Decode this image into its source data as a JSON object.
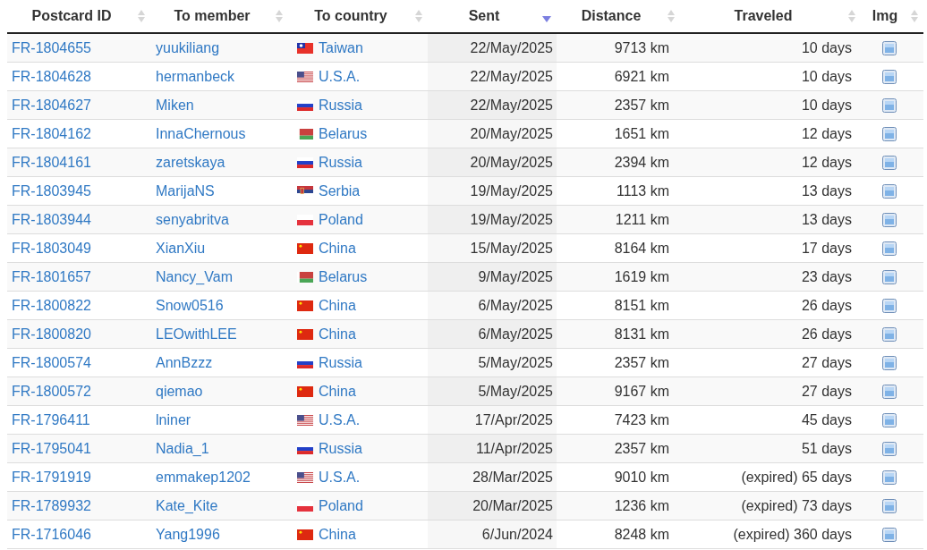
{
  "table": {
    "columns": [
      {
        "label": "Postcard ID",
        "sorted": false
      },
      {
        "label": "To member",
        "sorted": false
      },
      {
        "label": "To country",
        "sorted": false
      },
      {
        "label": "Sent",
        "sorted": true
      },
      {
        "label": "Distance",
        "sorted": false
      },
      {
        "label": "Traveled",
        "sorted": false
      },
      {
        "label": "Img",
        "sorted": false
      }
    ],
    "rows": [
      {
        "id": "FR-1804655",
        "member": "yuukiliang",
        "country": {
          "kind": "tw",
          "name": "Taiwan"
        },
        "sent": "22/May/2025",
        "distance": "9713 km",
        "traveled": "10 days"
      },
      {
        "id": "FR-1804628",
        "member": "hermanbeck",
        "country": {
          "kind": "us",
          "name": "U.S.A."
        },
        "sent": "22/May/2025",
        "distance": "6921 km",
        "traveled": "10 days"
      },
      {
        "id": "FR-1804627",
        "member": "Miken",
        "country": {
          "kind": "ru",
          "name": "Russia"
        },
        "sent": "22/May/2025",
        "distance": "2357 km",
        "traveled": "10 days"
      },
      {
        "id": "FR-1804162",
        "member": "InnaChernous",
        "country": {
          "kind": "by",
          "name": "Belarus"
        },
        "sent": "20/May/2025",
        "distance": "1651 km",
        "traveled": "12 days"
      },
      {
        "id": "FR-1804161",
        "member": "zaretskaya",
        "country": {
          "kind": "ru",
          "name": "Russia"
        },
        "sent": "20/May/2025",
        "distance": "2394 km",
        "traveled": "12 days"
      },
      {
        "id": "FR-1803945",
        "member": "MarijaNS",
        "country": {
          "kind": "rs",
          "name": "Serbia"
        },
        "sent": "19/May/2025",
        "distance": "1113 km",
        "traveled": "13 days"
      },
      {
        "id": "FR-1803944",
        "member": "senyabritva",
        "country": {
          "kind": "pl",
          "name": "Poland"
        },
        "sent": "19/May/2025",
        "distance": "1211 km",
        "traveled": "13 days"
      },
      {
        "id": "FR-1803049",
        "member": "XianXiu",
        "country": {
          "kind": "cn",
          "name": "China"
        },
        "sent": "15/May/2025",
        "distance": "8164 km",
        "traveled": "17 days"
      },
      {
        "id": "FR-1801657",
        "member": "Nancy_Vam",
        "country": {
          "kind": "by",
          "name": "Belarus"
        },
        "sent": "9/May/2025",
        "distance": "1619 km",
        "traveled": "23 days"
      },
      {
        "id": "FR-1800822",
        "member": "Snow0516",
        "country": {
          "kind": "cn",
          "name": "China"
        },
        "sent": "6/May/2025",
        "distance": "8151 km",
        "traveled": "26 days"
      },
      {
        "id": "FR-1800820",
        "member": "LEOwithLEE",
        "country": {
          "kind": "cn",
          "name": "China"
        },
        "sent": "6/May/2025",
        "distance": "8131 km",
        "traveled": "26 days"
      },
      {
        "id": "FR-1800574",
        "member": "AnnBzzz",
        "country": {
          "kind": "ru",
          "name": "Russia"
        },
        "sent": "5/May/2025",
        "distance": "2357 km",
        "traveled": "27 days"
      },
      {
        "id": "FR-1800572",
        "member": "qiemao",
        "country": {
          "kind": "cn",
          "name": "China"
        },
        "sent": "5/May/2025",
        "distance": "9167 km",
        "traveled": "27 days"
      },
      {
        "id": "FR-1796411",
        "member": "lniner",
        "country": {
          "kind": "us",
          "name": "U.S.A."
        },
        "sent": "17/Apr/2025",
        "distance": "7423 km",
        "traveled": "45 days"
      },
      {
        "id": "FR-1795041",
        "member": "Nadia_1",
        "country": {
          "kind": "ru",
          "name": "Russia"
        },
        "sent": "11/Apr/2025",
        "distance": "2357 km",
        "traveled": "51 days"
      },
      {
        "id": "FR-1791919",
        "member": "emmakep1202",
        "country": {
          "kind": "us",
          "name": "U.S.A."
        },
        "sent": "28/Mar/2025",
        "distance": "9010 km",
        "traveled": "(expired) 65 days"
      },
      {
        "id": "FR-1789932",
        "member": "Kate_Kite",
        "country": {
          "kind": "pl",
          "name": "Poland"
        },
        "sent": "20/Mar/2025",
        "distance": "1236 km",
        "traveled": "(expired) 73 days"
      },
      {
        "id": "FR-1716046",
        "member": "Yang1996",
        "country": {
          "kind": "cn",
          "name": "China"
        },
        "sent": "6/Jun/2024",
        "distance": "8248 km",
        "traveled": "(expired) 360 days"
      }
    ]
  }
}
